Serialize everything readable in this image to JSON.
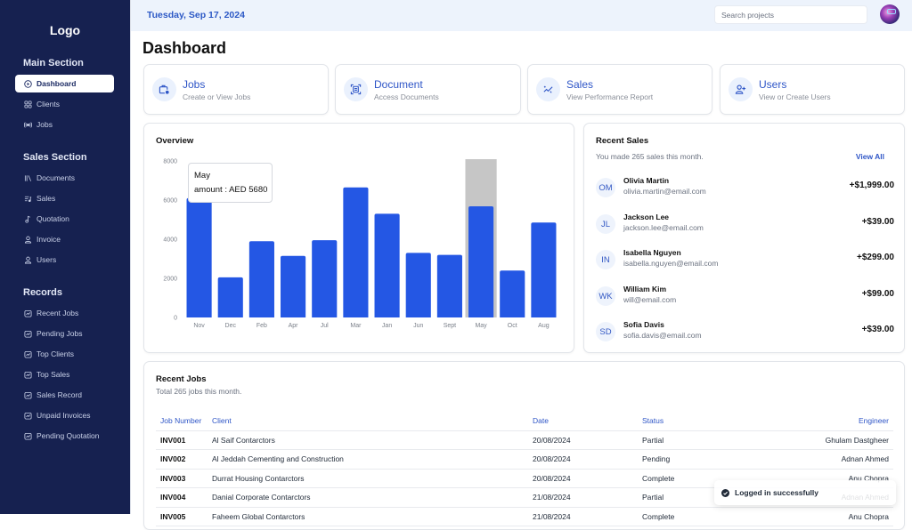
{
  "sidebar": {
    "logo": "Logo",
    "sections": [
      {
        "title": "Main Section",
        "items": [
          {
            "label": "Dashboard",
            "icon": "play-circle-icon",
            "active": true
          },
          {
            "label": "Clients",
            "icon": "grid-icon"
          },
          {
            "label": "Jobs",
            "icon": "broadcast-icon"
          }
        ]
      },
      {
        "title": "Sales Section",
        "items": [
          {
            "label": "Documents",
            "icon": "library-icon"
          },
          {
            "label": "Sales",
            "icon": "list-music-icon"
          },
          {
            "label": "Quotation",
            "icon": "music-note-icon"
          },
          {
            "label": "Invoice",
            "icon": "user-icon"
          },
          {
            "label": "Users",
            "icon": "user-icon"
          }
        ]
      },
      {
        "title": "Records",
        "items": [
          {
            "label": "Recent Jobs",
            "icon": "chart-square-icon"
          },
          {
            "label": "Pending Jobs",
            "icon": "chart-square-icon"
          },
          {
            "label": "Top Clients",
            "icon": "chart-square-icon"
          },
          {
            "label": "Top Sales",
            "icon": "chart-square-icon"
          },
          {
            "label": "Sales Record",
            "icon": "chart-square-icon"
          },
          {
            "label": "Unpaid Invoices",
            "icon": "chart-square-icon"
          },
          {
            "label": "Pending Quotation",
            "icon": "chart-square-icon"
          }
        ]
      }
    ]
  },
  "header": {
    "date": "Tuesday, Sep 17, 2024",
    "search_placeholder": "Search projects"
  },
  "page_title": "Dashboard",
  "quick_cards": [
    {
      "title": "Jobs",
      "subtitle": "Create or View Jobs",
      "icon": "briefcase-clock-icon"
    },
    {
      "title": "Document",
      "subtitle": "Access Documents",
      "icon": "document-scan-icon"
    },
    {
      "title": "Sales",
      "subtitle": "View Performance Report",
      "icon": "trend-sparkle-icon"
    },
    {
      "title": "Users",
      "subtitle": "View or Create Users",
      "icon": "user-plus-icon"
    }
  ],
  "overview": {
    "title": "Overview",
    "tooltip": {
      "label": "May",
      "text": "amount : AED 5680"
    }
  },
  "chart_data": {
    "type": "bar",
    "title": "Overview",
    "categories": [
      "Nov",
      "Dec",
      "Feb",
      "Apr",
      "Jul",
      "Mar",
      "Jan",
      "Jun",
      "Sept",
      "May",
      "Oct",
      "Aug"
    ],
    "series": [
      {
        "name": "amount",
        "values": [
          6100,
          2050,
          3900,
          3150,
          3950,
          6650,
          5300,
          3300,
          3200,
          5680,
          2400,
          4850
        ]
      }
    ],
    "xlabel": "",
    "ylabel": "",
    "ylim": [
      0,
      8000
    ],
    "yticks": [
      0,
      2000,
      4000,
      6000,
      8000
    ],
    "grid": false,
    "highlighted_category": "May",
    "bar_color": "#2457e4",
    "highlight_color": "#c6c6c6"
  },
  "recent_sales": {
    "title": "Recent Sales",
    "subtitle": "You made 265 sales this month.",
    "view_all": "View All",
    "items": [
      {
        "initials": "OM",
        "name": "Olivia Martin",
        "email": "olivia.martin@email.com",
        "amount": "+$1,999.00"
      },
      {
        "initials": "JL",
        "name": "Jackson Lee",
        "email": "jackson.lee@email.com",
        "amount": "+$39.00"
      },
      {
        "initials": "IN",
        "name": "Isabella Nguyen",
        "email": "isabella.nguyen@email.com",
        "amount": "+$299.00"
      },
      {
        "initials": "WK",
        "name": "William Kim",
        "email": "will@email.com",
        "amount": "+$99.00"
      },
      {
        "initials": "SD",
        "name": "Sofia Davis",
        "email": "sofia.davis@email.com",
        "amount": "+$39.00"
      }
    ]
  },
  "recent_jobs": {
    "title": "Recent Jobs",
    "subtitle": "Total 265 jobs this month.",
    "columns": [
      "Job Number",
      "Client",
      "Date",
      "Status",
      "Engineer"
    ],
    "rows": [
      [
        "INV001",
        "Al Saif Contarctors",
        "20/08/2024",
        "Partial",
        "Ghulam Dastgheer"
      ],
      [
        "INV002",
        "Al Jeddah Cementing and Construction",
        "20/08/2024",
        "Pending",
        "Adnan Ahmed"
      ],
      [
        "INV003",
        "Durrat Housing Contarctors",
        "20/08/2024",
        "Complete",
        "Anu Chopra"
      ],
      [
        "INV004",
        "Danial Corporate Contarctors",
        "21/08/2024",
        "Partial",
        "Adnan Ahmed"
      ],
      [
        "INV005",
        "Faheem Global Contarctors",
        "21/08/2024",
        "Complete",
        "Anu Chopra"
      ]
    ]
  },
  "toast": {
    "message": "Logged in successfully",
    "icon": "check-circle-icon"
  }
}
